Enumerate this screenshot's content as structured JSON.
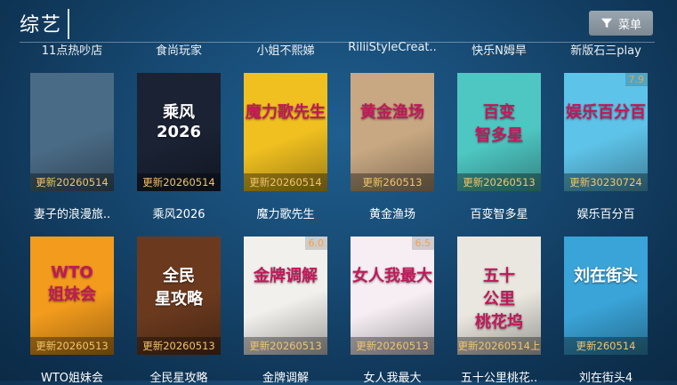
{
  "header": {
    "title": "综艺",
    "menu_label": "菜单"
  },
  "top_row": [
    "11点热吵店",
    "食尚玩家",
    "小姐不熙娣",
    "RiliiStyleCreat..",
    "快乐N姆旱",
    "新版石三play"
  ],
  "row1": [
    {
      "title": "妻子的浪漫旅..",
      "update": "更新20260514",
      "score": "",
      "color": "#4a6b86",
      "text": ""
    },
    {
      "title": "乘风2026",
      "update": "更新20260514",
      "score": "",
      "color": "#1a2233",
      "text": "乘风\n2026"
    },
    {
      "title": "魔力歌先生",
      "update": "更新20260514",
      "score": "",
      "color": "#f0c020",
      "text": "魔力歌先生"
    },
    {
      "title": "黄金渔场",
      "update": "更新260513",
      "score": "",
      "color": "#c8a882",
      "text": "黄金渔场"
    },
    {
      "title": "百变智多星",
      "update": "更新20260513",
      "score": "",
      "color": "#4ec7c2",
      "text": "百变\n智多星"
    },
    {
      "title": "娱乐百分百",
      "update": "更新30230724",
      "score": "7.9",
      "color": "#5ec3e8",
      "text": "娱乐百分百"
    }
  ],
  "row2": [
    {
      "title": "WTO姐妹会",
      "update": "更新20260513",
      "score": "",
      "color": "#f29b1c",
      "text": "WTO\n姐妹会"
    },
    {
      "title": "全民星攻略",
      "update": "更新20260513",
      "score": "",
      "color": "#6b3a1e",
      "text": "全民\n星攻略"
    },
    {
      "title": "金牌调解",
      "update": "更新20260513",
      "score": "6.0",
      "color": "#f2f0ec",
      "text": "金牌调解"
    },
    {
      "title": "女人我最大",
      "update": "更新20260513",
      "score": "6.5",
      "color": "#f6eef3",
      "text": "女人我最大"
    },
    {
      "title": "五十公里桃花..",
      "update": "更新20260514上",
      "score": "",
      "color": "#e9e7df",
      "text": "五十\n公里\n桃花坞"
    },
    {
      "title": "刘在街头4",
      "update": "更新260514",
      "score": "",
      "color": "#3aa4d8",
      "text": "刘在街头"
    }
  ]
}
